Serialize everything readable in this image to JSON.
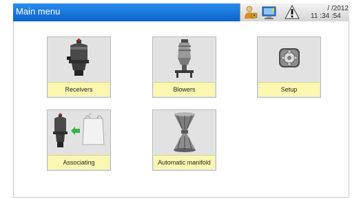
{
  "window": {
    "title": "Main menu"
  },
  "status": {
    "date": "/ /2012",
    "time": "11 :34 :54",
    "icons": [
      "user-login-icon",
      "monitor-icon",
      "alarm-warning-icon"
    ]
  },
  "menu": {
    "items": [
      {
        "label": "Receivers",
        "icon": "receiver-icon"
      },
      {
        "label": "Blowers",
        "icon": "blower-icon"
      },
      {
        "label": "Setup",
        "icon": "setup-gear-icon"
      },
      {
        "label": "Associating",
        "icon": "associating-icon"
      },
      {
        "label": "Automatic manifold",
        "icon": "automatic-manifold-icon"
      }
    ]
  }
}
